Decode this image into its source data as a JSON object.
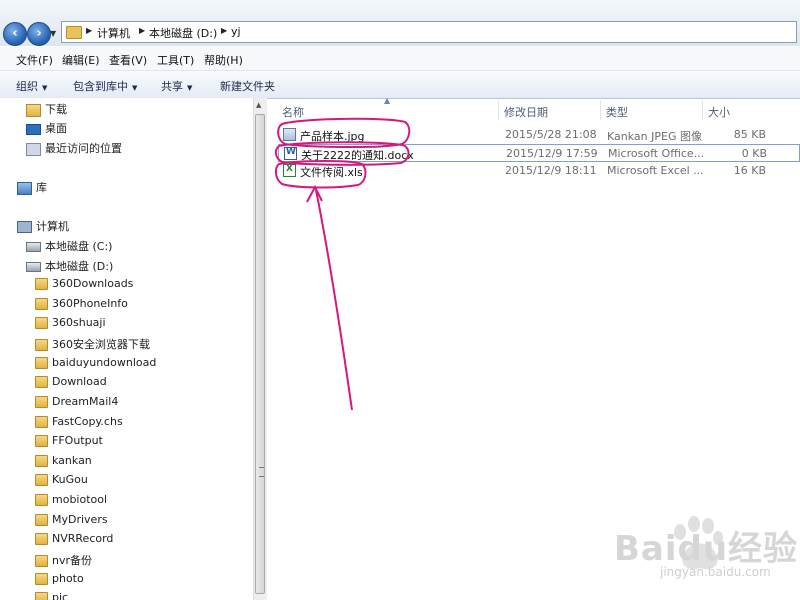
{
  "address": {
    "crumbs": [
      "计算机",
      "本地磁盘 (D:)",
      "yj"
    ]
  },
  "menu": [
    "文件(F)",
    "编辑(E)",
    "查看(V)",
    "工具(T)",
    "帮助(H)"
  ],
  "toolbar": {
    "organize": "组织",
    "include_in_library": "包含到库中",
    "share": "共享",
    "new_folder": "新建文件夹"
  },
  "nav": {
    "downloads": "下载",
    "desktop": "桌面",
    "recent": "最近访问的位置",
    "libraries": "库",
    "computer": "计算机",
    "drive_c": "本地磁盘 (C:)",
    "drive_d": "本地磁盘 (D:)",
    "folders": [
      "360Downloads",
      "360PhoneInfo",
      "360shuaji",
      "360安全浏览器下载",
      "baiduyundownload",
      "Download",
      "DreamMail4",
      "FastCopy.chs",
      "FFOutput",
      "kankan",
      "KuGou",
      "mobiotool",
      "MyDrivers",
      "NVRRecord",
      "nvr备份",
      "photo",
      "pic"
    ]
  },
  "columns": {
    "name": "名称",
    "modified": "修改日期",
    "type": "类型",
    "size": "大小"
  },
  "files": [
    {
      "name": "产品样本.jpg",
      "modified": "2015/5/28 21:08",
      "type": "Kankan JPEG 图像",
      "size": "85 KB",
      "icon": "image-file-icon"
    },
    {
      "name": "关于2222的通知.docx",
      "modified": "2015/12/9 17:59",
      "type": "Microsoft Office...",
      "size": "0 KB",
      "icon": "word-file-icon"
    },
    {
      "name": "文件传阅.xls",
      "modified": "2015/12/9 18:11",
      "type": "Microsoft Excel ...",
      "size": "16 KB",
      "icon": "excel-file-icon"
    }
  ],
  "watermark": {
    "main": "Baidu经验",
    "sub": "jingyan.baidu.com"
  },
  "colors": {
    "annotation": "#d4187f",
    "selection_border": "#7da2ce",
    "watermark": "#d6d6d6"
  }
}
